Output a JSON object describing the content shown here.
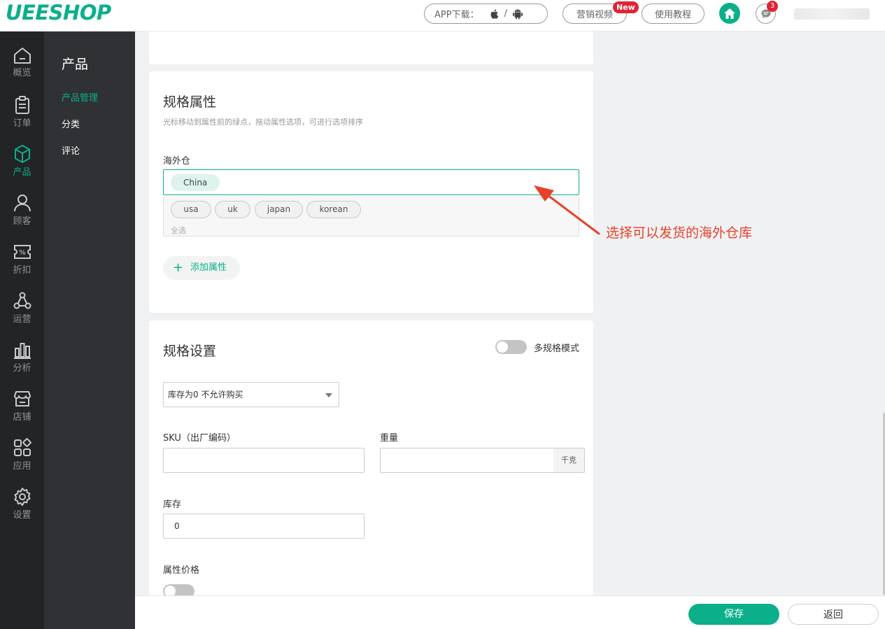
{
  "header": {
    "logo": "UEESHOP",
    "app_download": "APP下载：",
    "slash": "/",
    "marketing_video": "营销视频",
    "new_badge": "New",
    "tutorial": "使用教程",
    "message_count": "3"
  },
  "sidebar": {
    "items": [
      {
        "label": "概览",
        "icon": "home-outline-icon"
      },
      {
        "label": "订单",
        "icon": "clipboard-icon"
      },
      {
        "label": "产品",
        "icon": "box-icon",
        "active": true
      },
      {
        "label": "顾客",
        "icon": "user-icon"
      },
      {
        "label": "折扣",
        "icon": "coupon-icon"
      },
      {
        "label": "运营",
        "icon": "network-icon"
      },
      {
        "label": "分析",
        "icon": "bar-chart-icon"
      },
      {
        "label": "店铺",
        "icon": "store-icon"
      },
      {
        "label": "应用",
        "icon": "apps-icon"
      },
      {
        "label": "设置",
        "icon": "gear-icon"
      }
    ]
  },
  "subnav": {
    "title": "产品",
    "items": [
      {
        "label": "产品管理",
        "active": true
      },
      {
        "label": "分类"
      },
      {
        "label": "评论"
      }
    ]
  },
  "spec_attrs": {
    "title": "规格属性",
    "hint": "光标移动到属性前的绿点，拖动属性选项，可进行选项排序",
    "warehouse_label": "海外仓",
    "selected": [
      "China"
    ],
    "options": [
      "usa",
      "uk",
      "japan",
      "korean"
    ],
    "select_all": "全选",
    "add_attr": "添加属性"
  },
  "annotation": "选择可以发货的海外仓库",
  "spec_settings": {
    "title": "规格设置",
    "multi_spec_label": "多规格模式",
    "multi_spec_on": false,
    "stock_policy": "库存为0 不允许购买",
    "sku_label": "SKU（出厂编码）",
    "sku_value": "",
    "weight_label": "重量",
    "weight_value": "",
    "weight_unit": "千克",
    "stock_label": "库存",
    "stock_value": "0",
    "attr_price_label": "属性价格",
    "attr_price_on": false
  },
  "footer": {
    "save": "保存",
    "back": "返回"
  },
  "colors": {
    "brand": "#0baf8a",
    "badge": "#e02433",
    "annotation": "#e8412c"
  }
}
